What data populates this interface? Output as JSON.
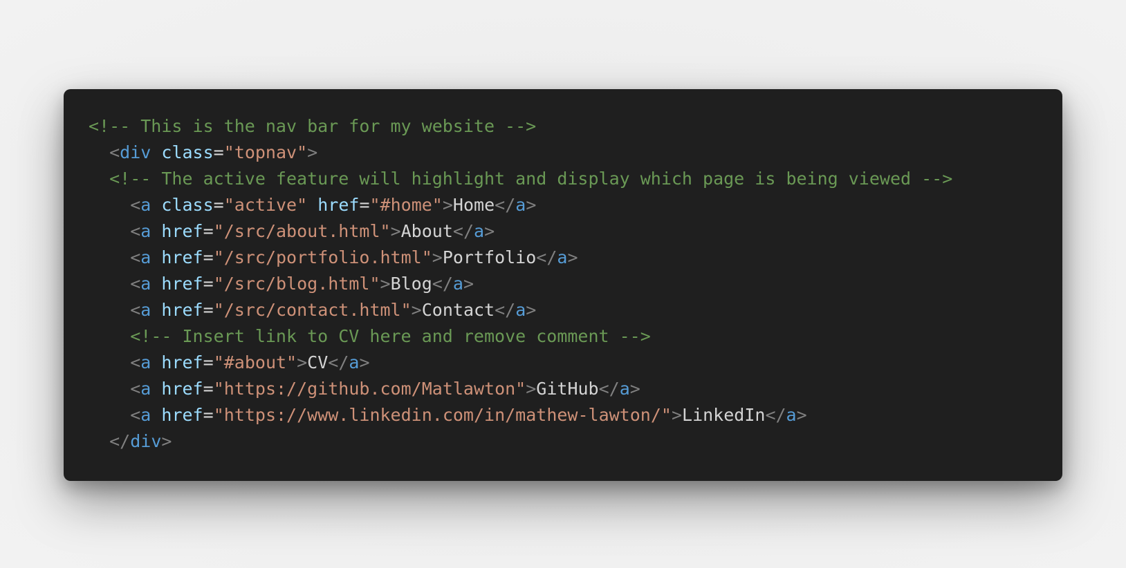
{
  "code": {
    "comment_1": "<!-- This is the nav bar for my website -->",
    "div_tag": "div",
    "div_attr": "class",
    "div_value": "\"topnav\"",
    "comment_2": "<!-- The active feature will highlight and display which page is being viewed -->",
    "links": [
      {
        "tag": "a",
        "attr1": "class",
        "val1": "\"active\"",
        "attr2": "href",
        "val2": "\"#home\"",
        "text": "Home"
      },
      {
        "tag": "a",
        "attr2": "href",
        "val2": "\"/src/about.html\"",
        "text": "About"
      },
      {
        "tag": "a",
        "attr2": "href",
        "val2": "\"/src/portfolio.html\"",
        "text": "Portfolio"
      },
      {
        "tag": "a",
        "attr2": "href",
        "val2": "\"/src/blog.html\"",
        "text": "Blog"
      },
      {
        "tag": "a",
        "attr2": "href",
        "val2": "\"/src/contact.html\"",
        "text": "Contact"
      }
    ],
    "comment_3": "<!-- Insert link to CV here and remove comment -->",
    "links_2": [
      {
        "tag": "a",
        "attr2": "href",
        "val2": "\"#about\"",
        "text": "CV"
      },
      {
        "tag": "a",
        "attr2": "href",
        "val2": "\"https://github.com/Matlawton\"",
        "text": "GitHub"
      },
      {
        "tag": "a",
        "attr2": "href",
        "val2": "\"https://www.linkedin.com/in/mathew-lawton/\"",
        "text": "LinkedIn"
      }
    ],
    "closing_div_tag": "div"
  },
  "colors": {
    "background": "#1f1f1f",
    "comment": "#6a9955",
    "punctuation": "#808080",
    "tag": "#569cd6",
    "attribute": "#9cdcfe",
    "string": "#ce9178",
    "text": "#d4d4d4"
  }
}
